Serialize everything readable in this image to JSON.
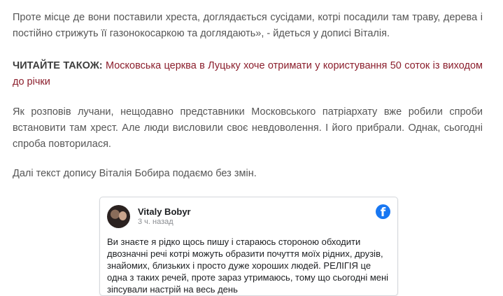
{
  "article": {
    "p1": "Проте місце де вони поставили хреста, доглядається сусідами, котрі посадили там траву, дерева і постійно стрижуть її газонокосаркою та доглядають», - йдеться у дописі Віталія.",
    "read_also_label": "ЧИТАЙТЕ ТАКОЖ:",
    "read_also_link": "Московська церква в Луцьку хоче отримати у користування 50 соток із виходом до річки",
    "p3": "Як розповів лучани, нещодавно представники Московського патріархату вже робили спроби встановити там хрест. Але люди висловили своє невдоволення. І його прибрали. Однак, сьогодні спроба повторилася.",
    "p4": "Далі текст допису Віталія Бобира подаємо без змін."
  },
  "fb_post": {
    "author": "Vitaly Bobyr",
    "time": "3 ч. назад",
    "logo": "f",
    "text": "Ви знаєте я рідко щось пишу і стараюсь стороною обходити двозначні речі котрі можуть образити почуття моїх рідних, друзів, знайомих, близьких і просто дуже хороших людей. РЕЛІГІЯ це одна з таких речей, проте зараз утримаюсь, тому що сьогодні мені зіпсували настрій на весь день"
  },
  "colors": {
    "text": "#555555",
    "link": "#8b1e2c",
    "facebook": "#1877f2"
  }
}
